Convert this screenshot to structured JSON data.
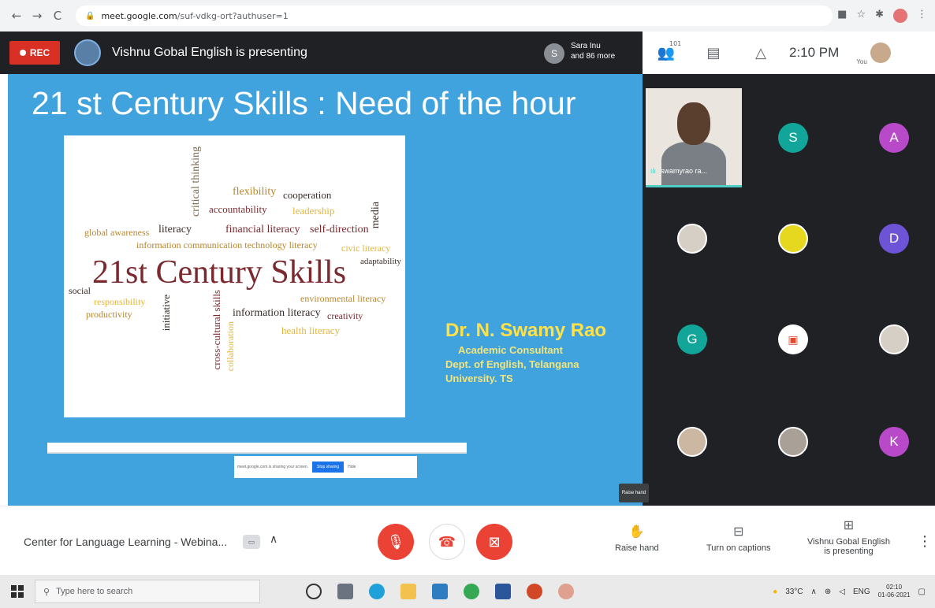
{
  "browser": {
    "back": "←",
    "forward": "→",
    "reload": "C",
    "url_host": "meet.google.com",
    "url_path": "/suf-vdkg-ort?authuser=1"
  },
  "meet_top": {
    "rec_label": "REC",
    "presenter_text": "Vishnu Gobal English is presenting",
    "people_initial": "S",
    "people_line1": "Sara Inu",
    "people_line2": "and 86 more",
    "participant_count": "101",
    "time": "2:10 PM",
    "you_label": "You"
  },
  "slide": {
    "title": "21 st  Century Skills : Need of the hour",
    "speaker_name": "Dr. N. Swamy Rao",
    "speaker_role": "Academic Consultant",
    "speaker_dept": "Dept. of English, Telangana",
    "speaker_univ": "University. TS",
    "share_text": "meet.google.com is sharing your screen.",
    "stop_sharing": "Stop sharing",
    "hide": "Hide"
  },
  "wordcloud": {
    "main": "21st Century Skills",
    "words": [
      "flexibility",
      "cooperation",
      "accountability",
      "leadership",
      "media",
      "critical thinking",
      "global awareness",
      "literacy",
      "financial literacy",
      "self-direction",
      "information communication technology literacy",
      "civic literacy",
      "adaptability",
      "social",
      "responsibility",
      "productivity",
      "initiative",
      "environmental literacy",
      "information literacy",
      "creativity",
      "health literacy",
      "cross-cultural skills",
      "collaboration"
    ]
  },
  "tiles": {
    "cam_name": "swamyrao ra...",
    "initials": [
      "S",
      "A",
      "D",
      "G",
      "K"
    ],
    "raise_tooltip": "Raise hand"
  },
  "controls": {
    "meeting_title": "Center for Language Learning - Webina...",
    "raise_hand": "Raise hand",
    "captions": "Turn on captions",
    "presenting_line1": "Vishnu Gobal English",
    "presenting_line2": "is presenting"
  },
  "taskbar": {
    "search_placeholder": "Type here to search",
    "temperature": "33°C",
    "lang": "ENG",
    "time": "02:10",
    "date": "01-06-2021"
  },
  "colors": {
    "slide_bg": "#41a3dd",
    "rec_red": "#d93025",
    "meet_dark": "#202124",
    "speaker_yellow": "#ffe14a",
    "wordcloud_main": "#7a2a2f"
  }
}
